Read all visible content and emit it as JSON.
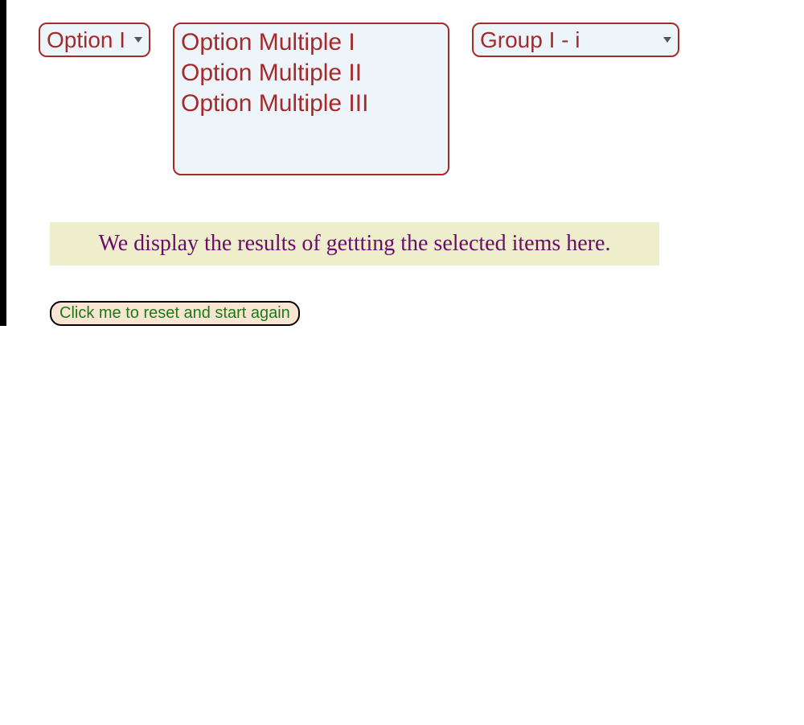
{
  "select_single": {
    "value": "Option I"
  },
  "select_multiple": {
    "options": [
      "Option Multiple I",
      "Option Multiple II",
      "Option Multiple III"
    ]
  },
  "select_group": {
    "value": "Group I - i"
  },
  "results_text": "We display the results of gettting the selected items here.",
  "reset_button_label": "Click me to reset and start again"
}
